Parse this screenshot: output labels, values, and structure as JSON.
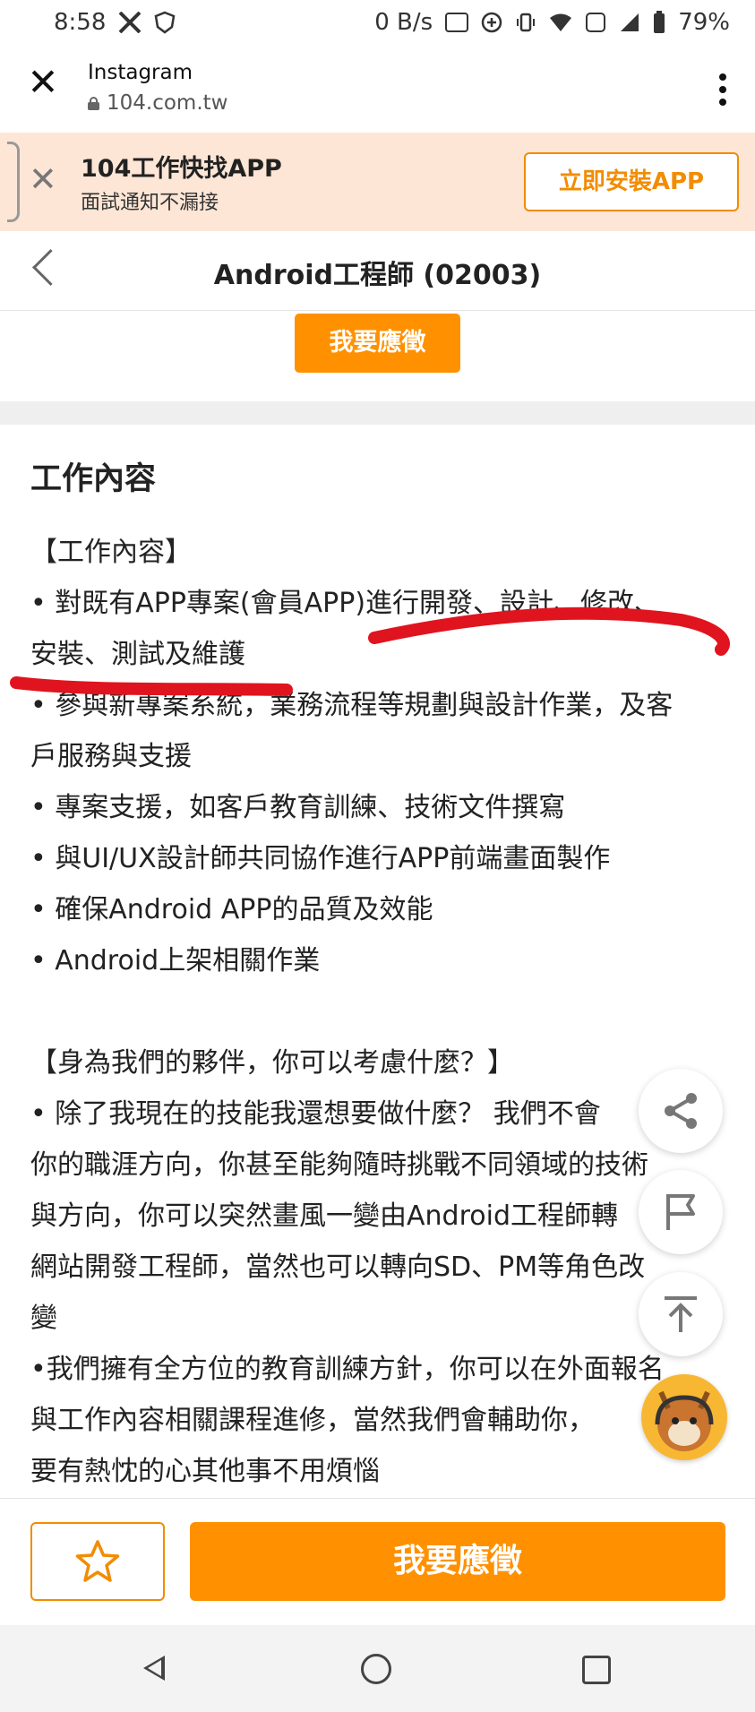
{
  "status_bar": {
    "time": "8:58",
    "network_speed": "0 B/s",
    "battery": "79%",
    "icons": [
      "x-icon",
      "shield-icon",
      "hz-120-icon",
      "data-saver-icon",
      "vibrate-icon",
      "wifi-icon",
      "volte-icon",
      "signal-icon",
      "battery-icon"
    ]
  },
  "browser": {
    "title": "Instagram",
    "url": "104.com.tw"
  },
  "banner": {
    "title": "104工作快找APP",
    "subtitle": "面試通知不漏接",
    "install_label": "立即安裝APP"
  },
  "header": {
    "title": "Android工程師 (02003)"
  },
  "apply_top_label": "我要應徵",
  "section": {
    "heading": "工作內容",
    "lines": [
      "【工作內容】",
      "• 對既有APP專案(會員APP)進行開發、設計、修改、",
      "安裝、測試及維護",
      "• 參與新專案系統，業務流程等規劃與設計作業，及客",
      "戶服務與支援",
      "• 專案支援，如客戶教育訓練、技術文件撰寫",
      "• 與UI/UX設計師共同協作進行APP前端畫面製作",
      "• 確保Android APP的品質及效能",
      "•  Android上架相關作業",
      "",
      "【身為我們的夥伴，你可以考慮什麼？】",
      "• 除了我現在的技能我還想要做什麼？ 我們不會",
      "你的職涯方向，你甚至能夠隨時挑戰不同領域的技術",
      "與方向，你可以突然畫風一變由Android工程師轉",
      "網站開發工程師，當然也可以轉向SD、PM等角色改",
      "變",
      "•我們擁有全方位的教育訓練方針，你可以在外面報名",
      "與工作內容相關課程進修，當然我們會輔助你，",
      "要有熱忱的心其他事不用煩惱"
    ]
  },
  "bottom": {
    "apply_label": "我要應徵"
  },
  "colors": {
    "accent": "#ff9100",
    "banner_bg": "#fde6d6",
    "annotation": "#e0141e"
  }
}
